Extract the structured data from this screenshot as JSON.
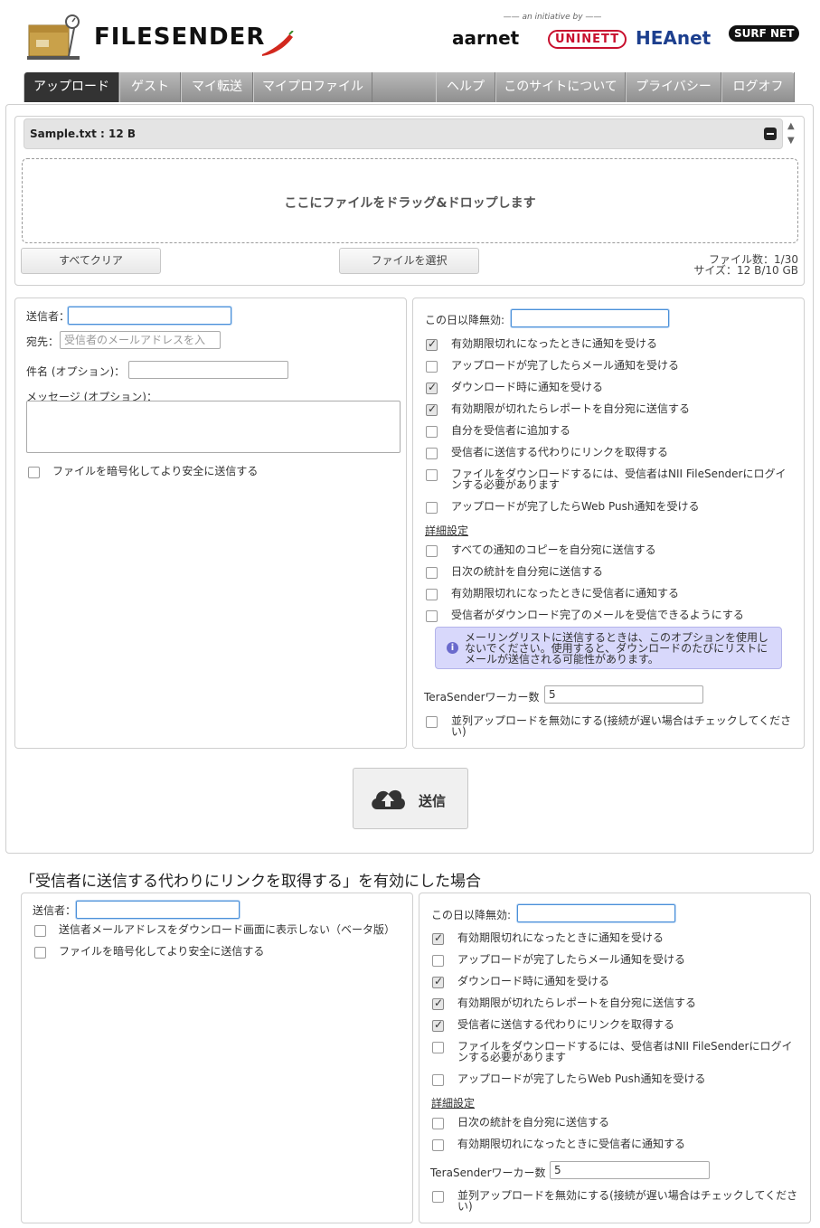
{
  "header": {
    "logo_text": "FILESENDER",
    "partners_tagline": "—— an initiative by ——",
    "partners": [
      "aarnet",
      "UNINETT",
      "HEAnet",
      "SURF NET"
    ]
  },
  "nav": {
    "tabs": [
      "アップロード",
      "ゲスト",
      "マイ転送",
      "マイプロファイル",
      "ヘルプ",
      "このサイトについて",
      "プライバシー",
      "ログオフ"
    ],
    "active": "アップロード"
  },
  "files": {
    "item": "Sample.txt : 12 B",
    "dropzone_text": "ここにファイルをドラッグ&ドロップします",
    "clear_all": "すべてクリア",
    "select_files": "ファイルを選択",
    "count": "ファイル数：1/30",
    "size": "サイズ：12 B/10 GB"
  },
  "left_form": {
    "sender_label": "送信者：",
    "sender_value": "",
    "to_label": "宛先：",
    "to_placeholder": "受信者のメールアドレスを入",
    "subject_label": "件名 (オプション)：",
    "message_label": "メッセージ (オプション)：",
    "encrypt_label": "ファイルを暗号化してより安全に送信する"
  },
  "right_form": {
    "expiry_label": "この日以降無効:",
    "options": [
      {
        "label": "有効期限切れになったときに通知を受ける",
        "checked": true
      },
      {
        "label": "アップロードが完了したらメール通知を受ける",
        "checked": false
      },
      {
        "label": "ダウンロード時に通知を受ける",
        "checked": true
      },
      {
        "label": "有効期限が切れたらレポートを自分宛に送信する",
        "checked": true
      },
      {
        "label": "自分を受信者に追加する",
        "checked": false
      },
      {
        "label": "受信者に送信する代わりにリンクを取得する",
        "checked": false
      },
      {
        "label": "ファイルをダウンロードするには、受信者はNII FileSenderにログインする必要があります",
        "checked": false
      },
      {
        "label": "アップロードが完了したらWeb Push通知を受ける",
        "checked": false
      }
    ],
    "advanced_label": "詳細設定",
    "advanced_options": [
      {
        "label": "すべての通知のコピーを自分宛に送信する",
        "checked": false
      },
      {
        "label": "日次の統計を自分宛に送信する",
        "checked": false
      },
      {
        "label": "有効期限切れになったときに受信者に通知する",
        "checked": false
      },
      {
        "label": "受信者がダウンロード完了のメールを受信できるようにする",
        "checked": false
      }
    ],
    "info_text": "メーリングリストに送信するときは、このオプションを使用しないでください。使用すると、ダウンロードのたびにリストにメールが送信される可能性があります。",
    "workers_label": "TeraSenderワーカー数",
    "workers_value": "5",
    "parallel_label": "並列アップロードを無効にする(接続が遅い場合はチェックしてください)"
  },
  "send": {
    "label": "送信"
  },
  "caption": "「受信者に送信する代わりにリンクを取得する」を有効にした場合",
  "alt_left": {
    "sender_label": "送信者：",
    "hide_sender_label": "送信者メールアドレスをダウンロード画面に表示しない（ベータ版）",
    "encrypt_label": "ファイルを暗号化してより安全に送信する"
  },
  "alt_right": {
    "expiry_label": "この日以降無効:",
    "options": [
      {
        "label": "有効期限切れになったときに通知を受ける",
        "checked": true
      },
      {
        "label": "アップロードが完了したらメール通知を受ける",
        "checked": false
      },
      {
        "label": "ダウンロード時に通知を受ける",
        "checked": true
      },
      {
        "label": "有効期限が切れたらレポートを自分宛に送信する",
        "checked": true
      },
      {
        "label": "受信者に送信する代わりにリンクを取得する",
        "checked": true
      },
      {
        "label": "ファイルをダウンロードするには、受信者はNII FileSenderにログインする必要があります",
        "checked": false
      },
      {
        "label": "アップロードが完了したらWeb Push通知を受ける",
        "checked": false
      }
    ],
    "advanced_label": "詳細設定",
    "advanced_options": [
      {
        "label": "日次の統計を自分宛に送信する",
        "checked": false
      },
      {
        "label": "有効期限切れになったときに受信者に通知する",
        "checked": false
      }
    ],
    "workers_label": "TeraSenderワーカー数",
    "workers_value": "5",
    "parallel_label": "並列アップロードを無効にする(接続が遅い場合はチェックしてください)"
  }
}
